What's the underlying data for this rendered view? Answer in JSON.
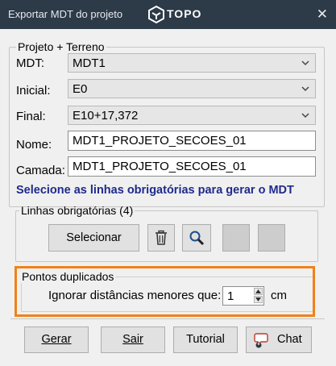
{
  "window": {
    "title": "Exportar MDT do projeto",
    "brand": "TOPO",
    "close_glyph": "✕"
  },
  "projeto_group": {
    "legend": "Projeto + Terreno",
    "mdt": {
      "label": "MDT:",
      "value": "MDT1"
    },
    "inicial": {
      "label": "Inicial:",
      "value": "E0"
    },
    "final": {
      "label": "Final:",
      "value": "E10+17,372"
    },
    "nome": {
      "label": "Nome:",
      "value": "MDT1_PROJETO_SECOES_01"
    },
    "camada": {
      "label": "Camada:",
      "value": "MDT1_PROJETO_SECOES_01"
    }
  },
  "hint": "Selecione as linhas obrigatórias para gerar o MDT",
  "linhas_group": {
    "legend": "Linhas obrigatórias (4)",
    "selecionar_label": "Selecionar",
    "delete_icon": "trash-icon",
    "zoom_icon": "magnifier-icon"
  },
  "pontos_group": {
    "legend": "Pontos duplicados",
    "label": "Ignorar distâncias menores que:",
    "value": "1",
    "unit": "cm"
  },
  "buttons": {
    "gerar": "Gerar",
    "sair": "Sair",
    "tutorial": "Tutorial",
    "chat": "Chat"
  },
  "colors": {
    "titlebar": "#2d3a48",
    "hint": "#1f2a8c",
    "highlight": "#f08218"
  }
}
